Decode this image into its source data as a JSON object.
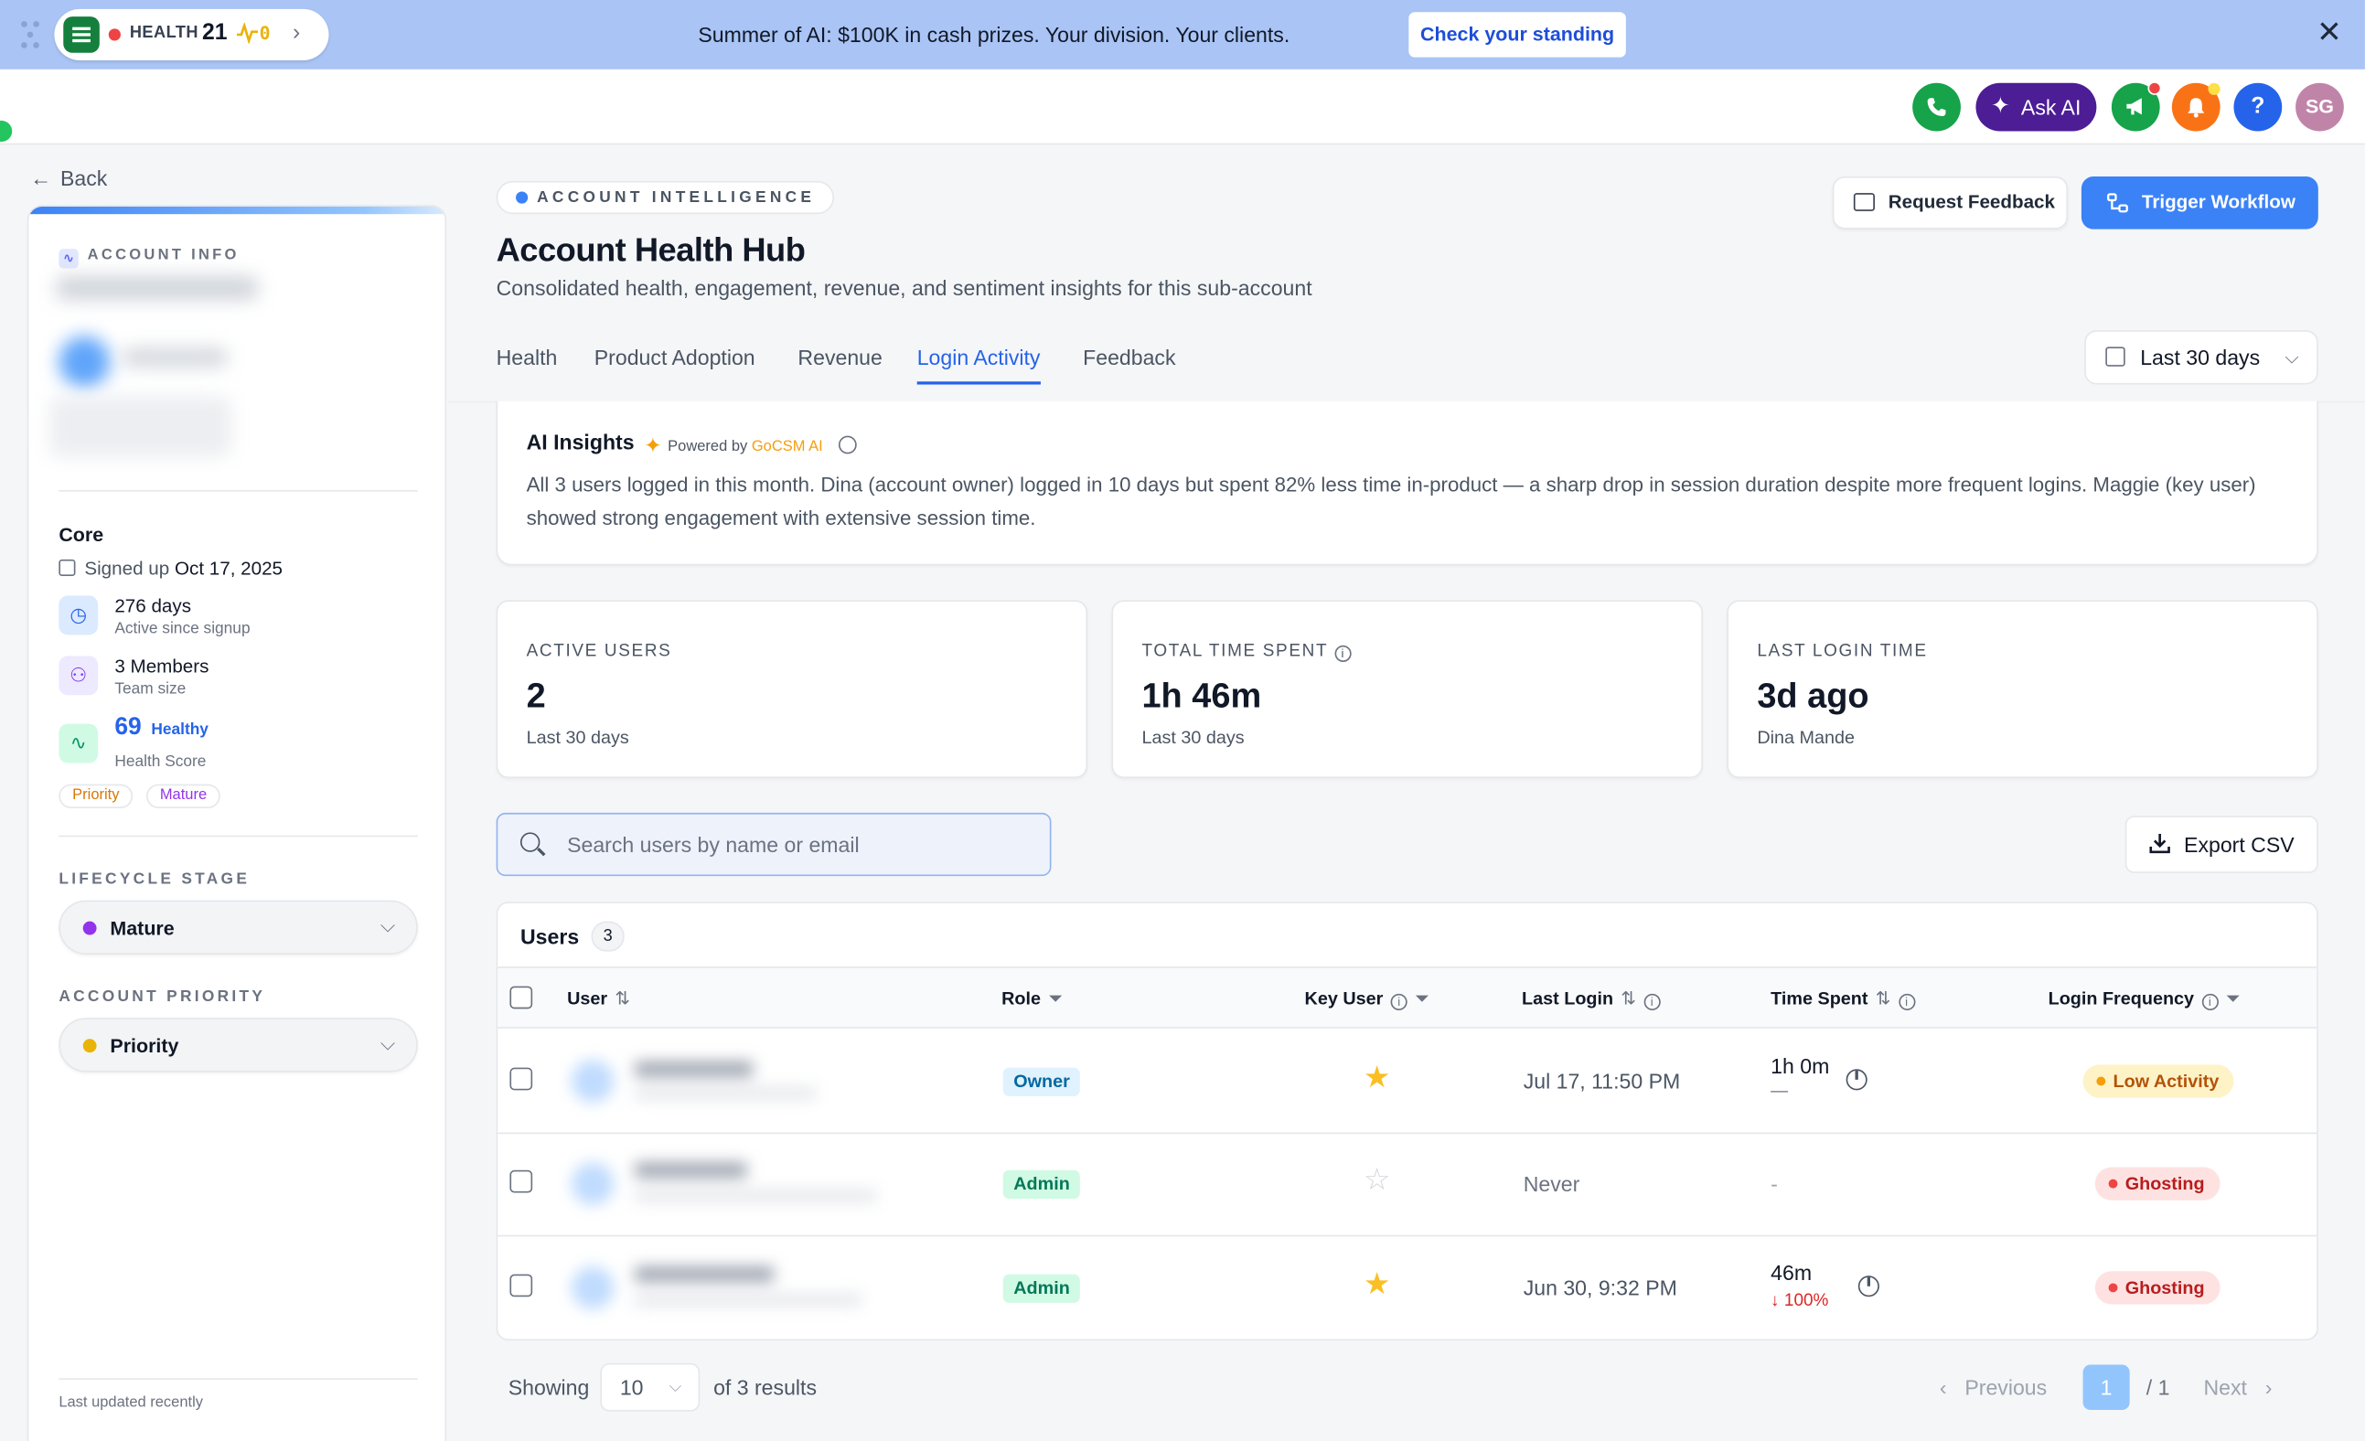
{
  "banner": {
    "health_label": "HEALTH",
    "health_score": "21",
    "health_delta": "0",
    "message": "Summer of AI: $100K in cash prizes. Your division. Your clients.",
    "cta": "Check your standing",
    "close_icon": "close-icon"
  },
  "topbar": {
    "ask_ai": "Ask AI",
    "help": "?",
    "avatar_initials": "SG",
    "icons": [
      "phone-icon",
      "sparkles-icon",
      "megaphone-icon",
      "bell-icon",
      "help-icon"
    ]
  },
  "nav": {
    "back": "Back"
  },
  "sidebar": {
    "section_title": "ACCOUNT INFO",
    "core_title": "Core",
    "signed_up_label": "Signed up",
    "signed_up_date": "Oct 17, 2025",
    "stats": [
      {
        "main": "276 days",
        "sub": "Active since signup",
        "icon": "clock-icon",
        "color": "#dbeafe"
      },
      {
        "main": "3 Members",
        "sub": "Team size",
        "icon": "users-icon",
        "color": "#ede9fe"
      },
      {
        "main": "69",
        "badge": "Healthy",
        "sub": "Health Score",
        "icon": "activity-icon",
        "color": "#d1fae5"
      }
    ],
    "tags": [
      "Priority",
      "Mature"
    ],
    "lifecycle_label": "LIFECYCLE STAGE",
    "lifecycle_value": "Mature",
    "lifecycle_color": "#9333ea",
    "priority_label": "ACCOUNT PRIORITY",
    "priority_value": "Priority",
    "priority_color": "#eab308",
    "last_updated": "Last updated recently"
  },
  "header": {
    "eyebrow": "ACCOUNT INTELLIGENCE",
    "title": "Account Health Hub",
    "subtitle": "Consolidated health, engagement, revenue, and sentiment insights for this sub-account",
    "request_feedback": "Request Feedback",
    "trigger_workflow": "Trigger Workflow"
  },
  "tabs": [
    {
      "label": "Health",
      "active": false
    },
    {
      "label": "Product Adoption",
      "active": false
    },
    {
      "label": "Revenue",
      "active": false
    },
    {
      "label": "Login Activity",
      "active": true
    },
    {
      "label": "Feedback",
      "active": false
    }
  ],
  "date_range": "Last 30 days",
  "ai_insights": {
    "title": "AI Insights",
    "powered_by": "Powered by",
    "brand": "GoCSM AI",
    "body": "All 3 users logged in this month. Dina (account owner) logged in 10 days but spent 82% less time in-product — a sharp drop in session duration despite more frequent logins. Maggie (key user) showed strong engagement with extensive session time."
  },
  "kpis": [
    {
      "label": "ACTIVE USERS",
      "value": "2",
      "caption": "Last 30 days",
      "info": false
    },
    {
      "label": "TOTAL TIME SPENT",
      "value": "1h 46m",
      "caption": "Last 30 days",
      "info": true
    },
    {
      "label": "LAST LOGIN TIME",
      "value": "3d ago",
      "caption": "Dina Mande",
      "info": false
    }
  ],
  "search": {
    "placeholder": "Search users by name or email"
  },
  "export_label": "Export CSV",
  "table": {
    "title": "Users",
    "count": "3",
    "columns": {
      "user": "User",
      "role": "Role",
      "key_user": "Key User",
      "last_login": "Last Login",
      "time_spent": "Time Spent",
      "login_frequency": "Login Frequency"
    },
    "rows": [
      {
        "role": "Owner",
        "role_kind": "owner",
        "key_user": true,
        "last_login": "Jul 17, 11:50 PM",
        "time_spent": "1h 0m",
        "time_sub": "—",
        "time_sub_kind": "neutral",
        "frequency": "Low Activity",
        "frequency_kind": "low"
      },
      {
        "role": "Admin",
        "role_kind": "admin",
        "key_user": false,
        "last_login": "Never",
        "time_spent": "-",
        "time_sub": "",
        "time_sub_kind": "neutral",
        "frequency": "Ghosting",
        "frequency_kind": "ghost"
      },
      {
        "role": "Admin",
        "role_kind": "admin",
        "key_user": true,
        "last_login": "Jun 30, 9:32 PM",
        "time_spent": "46m",
        "time_sub": "↓ 100%",
        "time_sub_kind": "drop",
        "frequency": "Ghosting",
        "frequency_kind": "ghost"
      }
    ]
  },
  "pagination": {
    "showing": "Showing",
    "page_size": "10",
    "of_results": "of 3 results",
    "previous": "Previous",
    "current_page": "1",
    "total_pages": "/ 1",
    "next": "Next"
  },
  "colors": {
    "accent": "#3b82f6",
    "banner_bg": "#a9c4f5",
    "ask_ai_bg": "#4c1d95"
  }
}
